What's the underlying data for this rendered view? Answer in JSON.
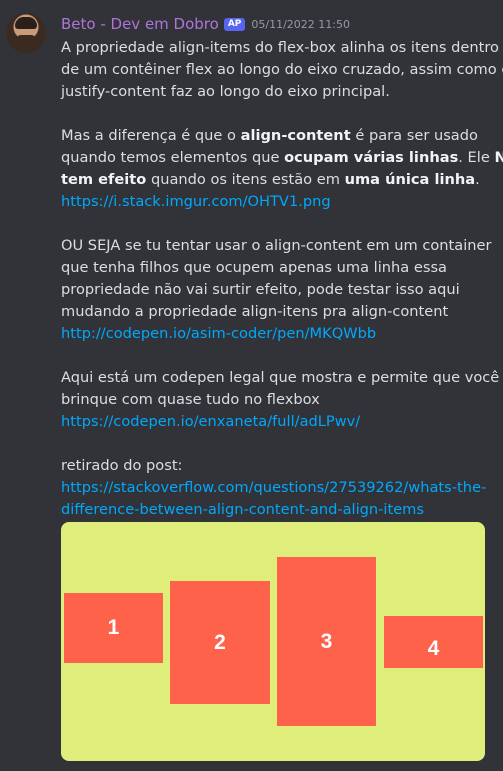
{
  "author": {
    "name": "Beto - Dev em Dobro",
    "badge": "AP",
    "timestamp": "05/11/2022 11:50"
  },
  "message": {
    "p1": {
      "line1": "A propriedade align-items do flex-box alinha os itens dentro",
      "line2": "de um contêiner flex ao longo do eixo cruzado, assim como o",
      "line3": "justify-content faz ao longo do eixo principal."
    },
    "p2": {
      "l1_a": "Mas a diferença é que o ",
      "l1_b": "align-content",
      "l1_c": " é para ser usado",
      "l2_a": "quando temos elementos que ",
      "l2_b": "ocupam várias linhas",
      "l2_c": ". Ele ",
      "l2_d": "Não",
      "l3_a": "tem efeito",
      "l3_b": " quando os itens estão em ",
      "l3_c": "uma única linha",
      "l3_d": ".",
      "link": "https://i.stack.imgur.com/OHTV1.png"
    },
    "p3": {
      "line1": "OU SEJA se tu tentar usar o align-content em um container",
      "line2": "que tenha filhos que ocupem apenas uma linha essa",
      "line3": "propriedade não vai surtir efeito, pode testar isso aqui",
      "line4": "mudando a propriedade align-itens pra align-content",
      "link": "http://codepen.io/asim-coder/pen/MKQWbb"
    },
    "p4": {
      "line1": "Aqui está um codepen legal que mostra e permite que você",
      "line2": "brinque com quase tudo no flexbox",
      "link": "https://codepen.io/enxaneta/full/adLPwv/"
    },
    "p5": {
      "line1": "retirado do post:",
      "link_line1": "https://stackoverflow.com/questions/27539262/whats-the-",
      "link_line2": "difference-between-align-content-and-align-items"
    }
  },
  "embed": {
    "background": "#dfee7a",
    "box_color": "#ff624a",
    "boxes": [
      "1",
      "2",
      "3",
      "4"
    ]
  }
}
